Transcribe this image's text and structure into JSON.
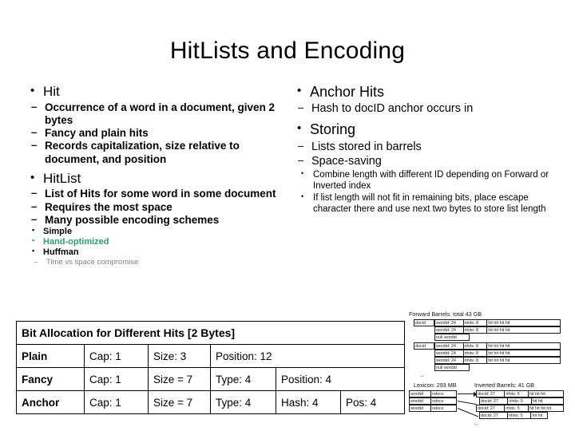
{
  "slide": {
    "title": "HitLists and Encoding",
    "background_color": "#ffffff",
    "accent_green": "#2e9e6b",
    "muted_gray": "#7f7f7f"
  },
  "left_column": {
    "items": [
      {
        "level": 1,
        "text": "Hit"
      },
      {
        "level": 2,
        "text": "Occurrence of a word in a document, given 2 bytes"
      },
      {
        "level": 2,
        "text": "Fancy and plain hits"
      },
      {
        "level": 2,
        "text": "Records capitalization, size relative to document, and position"
      },
      {
        "level": 1,
        "text": "HitList"
      },
      {
        "level": 2,
        "text": "List of Hits for some word in some document"
      },
      {
        "level": 2,
        "text": "Requires the most space"
      },
      {
        "level": 2,
        "text": "Many possible encoding schemes"
      },
      {
        "level": 3,
        "text": "Simple"
      },
      {
        "level": 3,
        "text": "Hand-optimized",
        "color": "#2e9e6b"
      },
      {
        "level": 3,
        "text": "Huffman"
      },
      {
        "level": 4,
        "text": "Time vs space compromise"
      }
    ]
  },
  "right_column": {
    "items": [
      {
        "level": 1,
        "text": "Anchor Hits"
      },
      {
        "level": 2,
        "text": "Hash to docID anchor occurs in"
      },
      {
        "level": 1,
        "text": "Storing"
      },
      {
        "level": 2,
        "text": "Lists stored in barrels"
      },
      {
        "level": 2,
        "text": "Space-saving"
      },
      {
        "level": 3,
        "text": "Combine length with different ID depending on Forward or Inverted index"
      },
      {
        "level": 3,
        "text": "If list length will not fit in remaining bits, place escape character there and use next two bytes to store list length"
      }
    ]
  },
  "bit_table": {
    "caption": "Bit Allocation for Different Hits [2 Bytes]",
    "rows": [
      {
        "label": "Plain",
        "cells": [
          "Cap: 1",
          "Size: 3",
          "Position: 12"
        ]
      },
      {
        "label": "Fancy",
        "cells": [
          "Cap: 1",
          "Size = 7",
          "Type: 4",
          "Position: 4"
        ]
      },
      {
        "label": "Anchor",
        "cells": [
          "Cap: 1",
          "Size = 7",
          "Type: 4",
          "Hash: 4",
          "Pos: 4"
        ]
      }
    ]
  },
  "figure": {
    "forward_caption": "Forward Barrels: total 43 GB",
    "lexicon_caption": "Lexicon: 293 MB",
    "inverted_caption": "Inverted Barrels: 41 GB",
    "forward_rows": [
      [
        "docid",
        "wordid: 24",
        "nhits: 8",
        "hit hit hit hit"
      ],
      [
        "",
        "wordid: 24",
        "nhits: 8",
        "hit hit hit hit"
      ],
      [
        "",
        "null wordid",
        "",
        ""
      ],
      [
        "docid",
        "wordid: 24",
        "nhits: 8",
        "hit hit hit hit"
      ],
      [
        "",
        "wordid: 24",
        "nhits: 8",
        "hit hit hit hit"
      ],
      [
        "",
        "wordid: 24",
        "nhits: 8",
        "hit hit hit hit"
      ],
      [
        "",
        "null wordid",
        "",
        ""
      ]
    ],
    "lexicon_rows": [
      [
        "wordid",
        "ndocs"
      ],
      [
        "wordid",
        "ndocs"
      ],
      [
        "wordid",
        "ndocs"
      ]
    ],
    "inverted_rows": [
      [
        "docid: 27",
        "nhits: 5",
        "hit hit hit"
      ],
      [
        "docid: 27",
        "nhits: 5",
        "hit hit"
      ],
      [
        "docid: 27",
        "nhits: 5",
        "hit hit hit hit"
      ],
      [
        "docid: 27",
        "nhits: 5",
        "hit hit"
      ]
    ],
    "ellipsis": ".."
  }
}
